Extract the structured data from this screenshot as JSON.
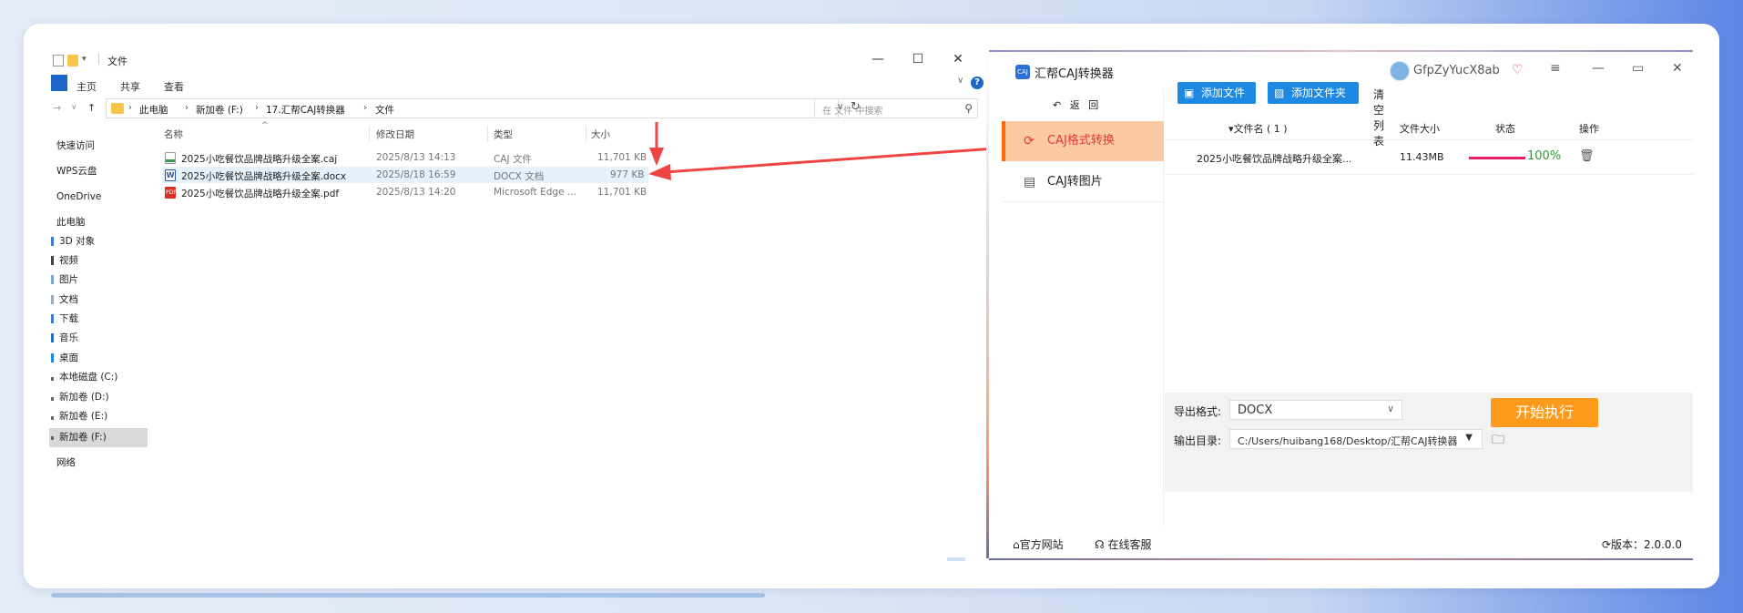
{
  "explorer": {
    "title": "文件",
    "ribbon_tabs": [
      "主页",
      "共享",
      "查看"
    ],
    "window_controls": {
      "minimize": "—",
      "maximize": "☐",
      "close": "✕"
    },
    "address": {
      "crumbs": [
        "此电脑",
        "新加卷 (F:)",
        "17.汇帮CAJ转换器",
        "文件"
      ]
    },
    "search_placeholder": "在 文件 中搜索",
    "nav_items": [
      "快速访问",
      "WPS云盘",
      "OneDrive",
      "此电脑",
      "3D 对象",
      "视频",
      "图片",
      "文档",
      "下载",
      "音乐",
      "桌面",
      "本地磁盘 (C:)",
      "新加卷 (D:)",
      "新加卷 (E:)",
      "新加卷 (F:)",
      "网络"
    ],
    "selected_nav": "新加卷 (F:)",
    "columns": [
      "名称",
      "修改日期",
      "类型",
      "大小"
    ],
    "files": [
      {
        "name": "2025小吃餐饮品牌战略升级全案.caj",
        "date": "2025/8/13 14:13",
        "type": "CAJ 文件",
        "size": "11,701 KB"
      },
      {
        "name": "2025小吃餐饮品牌战略升级全案.docx",
        "date": "2025/8/18 16:59",
        "type": "DOCX 文档",
        "size": "977 KB"
      },
      {
        "name": "2025小吃餐饮品牌战略升级全案.pdf",
        "date": "2025/8/13 14:20",
        "type": "Microsoft Edge ...",
        "size": "11,701 KB"
      }
    ]
  },
  "app": {
    "title": "汇帮CAJ转换器",
    "user_name": "GfpZyYucX8ab",
    "back_label": "返 回",
    "side_items": [
      "CAJ格式转换",
      "CAJ转图片"
    ],
    "toolbar": {
      "add_file": "添加文件",
      "add_folder": "添加文件夹",
      "clear": "清空列表"
    },
    "table_headers": {
      "name": "▾文件名 ( 1 )",
      "size": "文件大小",
      "status": "状态",
      "action": "操作"
    },
    "row": {
      "name": "2025小吃餐饮品牌战略升级全案...",
      "size": "11.43MB",
      "progress": 1.0,
      "progress_label": "100%"
    },
    "export_format_label": "导出格式:",
    "export_format": "DOCX",
    "output_dir_label": "输出目录:",
    "output_dir": "C:/Users/huibang168/Desktop/汇帮CAJ转换器",
    "start_label": "开始执行",
    "footer": {
      "website": "官方网站",
      "service": "在线客服",
      "version": "版本：2.0.0.0"
    },
    "colors": {
      "accent_blue": "#1e88e5",
      "active_bg": "#fbc9a2",
      "active_red": "#e53935",
      "start_orange": "#ff9a1a",
      "progress": "#e91e63",
      "pct_green": "#2e9d2e"
    }
  }
}
